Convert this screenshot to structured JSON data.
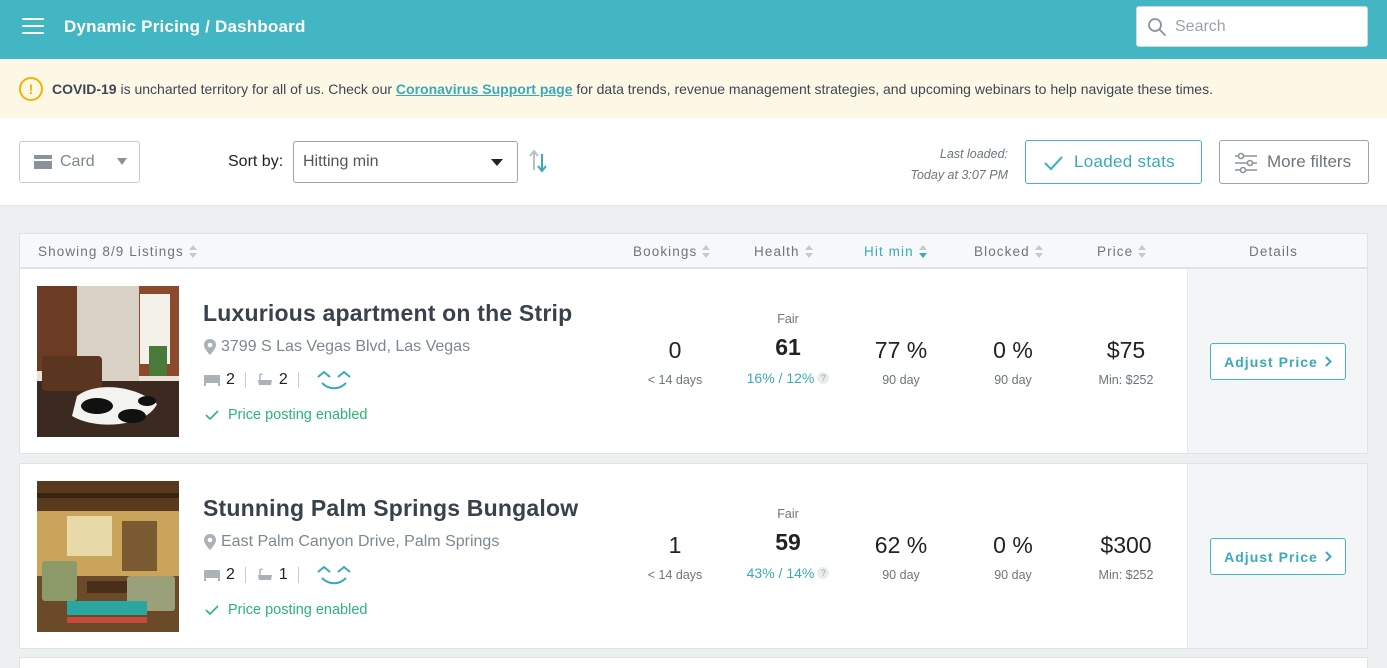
{
  "header": {
    "breadcrumb": "Dynamic Pricing / Dashboard",
    "search_placeholder": "Search"
  },
  "alert": {
    "bold": "COVID-19",
    "text_before": " is uncharted territory for all of us. Check our ",
    "link": "Coronavirus Support page",
    "text_after": " for data trends, revenue management strategies, and upcoming webinars to help navigate these times."
  },
  "toolbar": {
    "view_label": "Card",
    "sort_label": "Sort by:",
    "sort_value": "Hitting min",
    "last_loaded_label": "Last loaded:",
    "last_loaded_value": "Today at 3:07 PM",
    "loaded_stats_label": "Loaded stats",
    "more_filters_label": "More filters"
  },
  "table": {
    "columns": {
      "showing": "Showing 8/9 Listings",
      "bookings": "Bookings",
      "health": "Health",
      "hit_min": "Hit min",
      "blocked": "Blocked",
      "price": "Price",
      "details": "Details"
    },
    "listings": [
      {
        "title": "Luxurious apartment on the Strip",
        "address": "3799 S Las Vegas Blvd, Las Vegas",
        "bedrooms": "2",
        "bathrooms": "2",
        "posting": "Price posting enabled",
        "bookings": "0",
        "bookings_sub": "< 14 days",
        "health_label": "Fair",
        "health": "61",
        "health_ratio": "16% / 12%",
        "hit_min": "77 %",
        "hit_min_sub": "90 day",
        "blocked": "0 %",
        "blocked_sub": "90 day",
        "price": "$75",
        "price_min": "Min: $252",
        "adjust_label": "Adjust Price"
      },
      {
        "title": "Stunning Palm Springs Bungalow",
        "address": "East Palm Canyon Drive, Palm Springs",
        "bedrooms": "2",
        "bathrooms": "1",
        "posting": "Price posting enabled",
        "bookings": "1",
        "bookings_sub": "< 14 days",
        "health_label": "Fair",
        "health": "59",
        "health_ratio": "43% / 14%",
        "hit_min": "62 %",
        "hit_min_sub": "90 day",
        "blocked": "0 %",
        "blocked_sub": "90 day",
        "price": "$300",
        "price_min": "Min: $252",
        "adjust_label": "Adjust Price"
      }
    ]
  },
  "colors": {
    "brand": "#43b6c4",
    "accent_text": "#3aa9b8",
    "alert_bg": "#fdf8e6",
    "warning": "#f2b400",
    "success": "#2bb673"
  },
  "icons": [
    "hamburger-icon",
    "search-icon",
    "warning-icon",
    "card-view-icon",
    "sort-direction-icon",
    "check-icon",
    "sliders-icon",
    "location-pin-icon",
    "bed-icon",
    "bath-icon",
    "smile-logo-icon",
    "chevron-right-icon"
  ]
}
